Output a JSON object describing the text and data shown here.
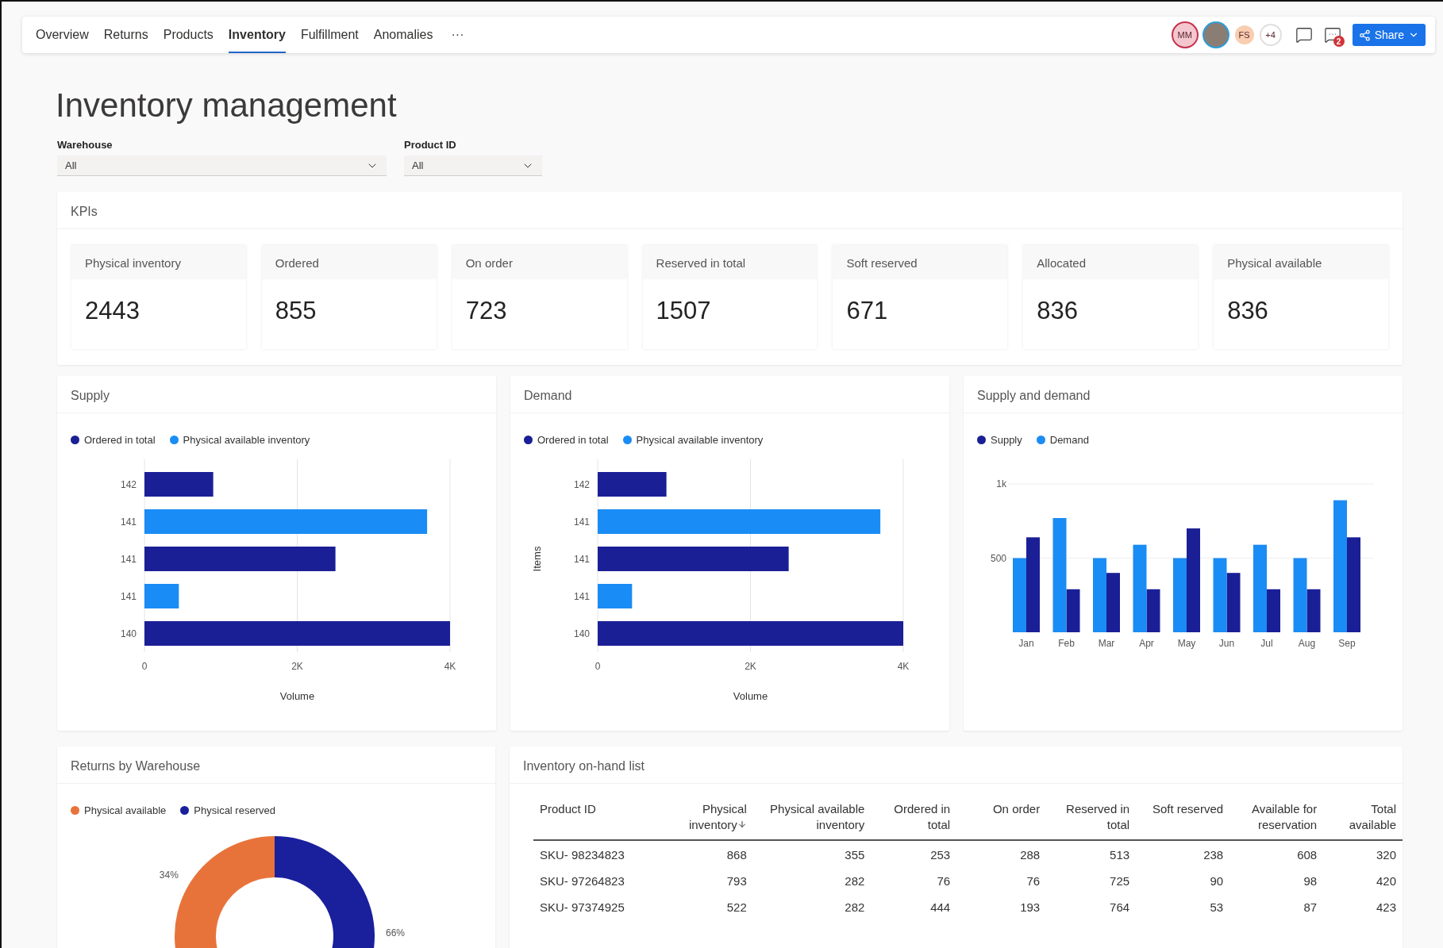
{
  "tabs": [
    {
      "label": "Overview",
      "selected": false
    },
    {
      "label": "Returns",
      "selected": false
    },
    {
      "label": "Products",
      "selected": false
    },
    {
      "label": "Inventory",
      "selected": true
    },
    {
      "label": "Fulfillment",
      "selected": false
    },
    {
      "label": "Anomalies",
      "selected": false
    }
  ],
  "more_tabs": "···",
  "collaborators": [
    {
      "kind": "initials",
      "label": "MM",
      "color": "#f4c7cf"
    },
    {
      "kind": "photo"
    },
    {
      "kind": "initials",
      "label": "FS",
      "color": "#f8cdb0"
    },
    {
      "kind": "count",
      "label": "+4"
    }
  ],
  "notifications": {
    "badge": "2"
  },
  "share_button": {
    "label": "Share"
  },
  "title": "Inventory management",
  "filters": [
    {
      "label": "Warehouse",
      "value": "All"
    },
    {
      "label": "Product ID",
      "value": "All"
    }
  ],
  "kpis": {
    "title": "KPIs",
    "cards": [
      {
        "label": "Physical inventory",
        "value": "2443"
      },
      {
        "label": "Ordered",
        "value": "855"
      },
      {
        "label": "On order",
        "value": "723"
      },
      {
        "label": "Reserved in total",
        "value": "1507"
      },
      {
        "label": "Soft reserved",
        "value": "671"
      },
      {
        "label": "Allocated",
        "value": "836"
      },
      {
        "label": "Physical available",
        "value": "836"
      }
    ]
  },
  "supply": {
    "title": "Supply",
    "chart_data": {
      "type": "bar",
      "orientation": "horizontal",
      "xlabel": "Volume",
      "categories": [
        "142",
        "141",
        "141",
        "141",
        "140"
      ],
      "series": [
        {
          "name": "Ordered in total",
          "color": "#1b1f96",
          "values": [
            900,
            null,
            2500,
            null,
            4000
          ]
        },
        {
          "name": "Physical available inventory",
          "color": "#1a8cf5",
          "values": [
            null,
            3700,
            null,
            450,
            null
          ]
        }
      ],
      "xlim": [
        0,
        4000
      ],
      "xticks": [
        0,
        {
          "value": 2000,
          "label": "2K"
        },
        {
          "value": 4000,
          "label": "4K"
        }
      ]
    }
  },
  "demand": {
    "title": "Demand",
    "chart_data": {
      "type": "bar",
      "orientation": "horizontal",
      "xlabel": "Volume",
      "ylabel": "Items",
      "categories": [
        "142",
        "141",
        "141",
        "141",
        "140"
      ],
      "series": [
        {
          "name": "Ordered in total",
          "color": "#1b1f96",
          "values": [
            900,
            null,
            2500,
            null,
            4000
          ]
        },
        {
          "name": "Physical available inventory",
          "color": "#1a8cf5",
          "values": [
            null,
            3700,
            null,
            450,
            null
          ]
        }
      ],
      "xlim": [
        0,
        4000
      ],
      "xticks": [
        0,
        {
          "value": 2000,
          "label": "2K"
        },
        {
          "value": 4000,
          "label": "4K"
        }
      ]
    }
  },
  "supply_and_demand": {
    "title": "Supply and demand",
    "chart_data": {
      "type": "bar",
      "orientation": "vertical",
      "categories": [
        "Jan",
        "Feb",
        "Mar",
        "Apr",
        "May",
        "Jun",
        "Jul",
        "Aug",
        "Sep"
      ],
      "series": [
        {
          "name": "Supply",
          "color": "#1b1f96",
          "values": [
            640,
            290,
            400,
            290,
            700,
            400,
            290,
            290,
            640
          ]
        },
        {
          "name": "Demand",
          "color": "#1a8cf5",
          "values": [
            500,
            770,
            500,
            590,
            500,
            500,
            590,
            500,
            890
          ]
        }
      ],
      "ylim": [
        0,
        1000
      ],
      "yticks": [
        {
          "value": 500,
          "label": "500"
        },
        {
          "value": 1000,
          "label": "1k"
        }
      ]
    }
  },
  "returns_by_warehouse": {
    "title": "Returns by Warehouse",
    "chart_data": {
      "type": "donut",
      "categories": [
        "Physical available",
        "Physical reserved"
      ],
      "colors": [
        "#e8733a",
        "#1a1f9c"
      ],
      "values": [
        34,
        66
      ],
      "value_labels": [
        "34%",
        "66%"
      ]
    }
  },
  "inventory_list": {
    "title": "Inventory on-hand list",
    "columns": [
      {
        "label": "Product ID",
        "sorted": false
      },
      {
        "label": "Physical inventory",
        "sorted": true
      },
      {
        "label": "Physical available inventory",
        "sorted": false
      },
      {
        "label": "Ordered in total",
        "sorted": false
      },
      {
        "label": "On order",
        "sorted": false
      },
      {
        "label": "Reserved in total",
        "sorted": false
      },
      {
        "label": "Soft reserved",
        "sorted": false
      },
      {
        "label": "Available for reservation",
        "sorted": false
      },
      {
        "label": "Total available",
        "sorted": false
      }
    ],
    "rows": [
      [
        "SKU- 98234823",
        "868",
        "355",
        "253",
        "288",
        "513",
        "238",
        "608",
        "320"
      ],
      [
        "SKU- 97264823",
        "793",
        "282",
        "76",
        "76",
        "725",
        "90",
        "98",
        "420"
      ],
      [
        "SKU- 97374925",
        "522",
        "282",
        "444",
        "193",
        "764",
        "53",
        "87",
        "423"
      ]
    ]
  }
}
